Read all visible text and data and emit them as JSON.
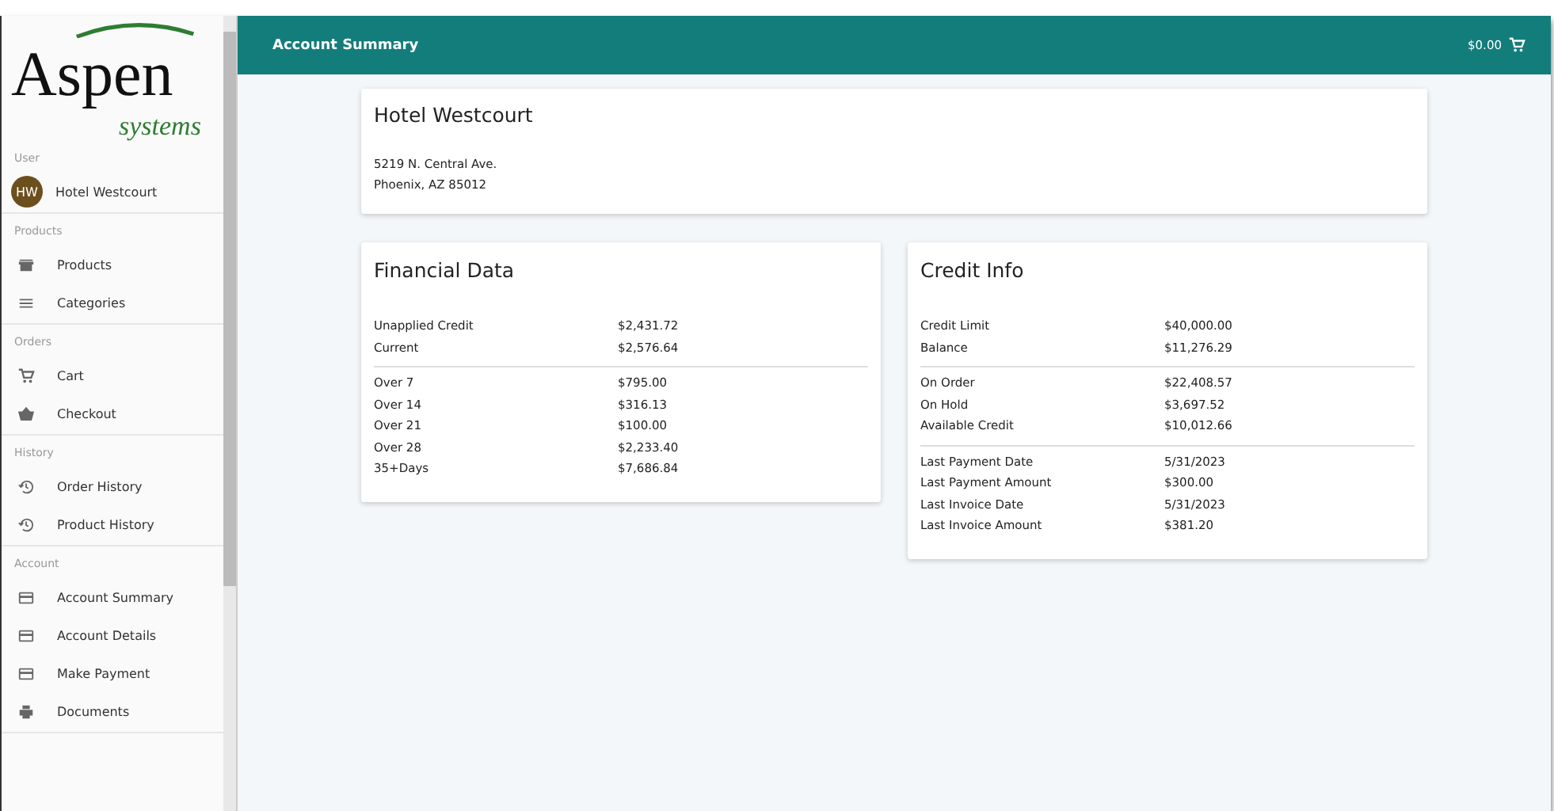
{
  "logo": {
    "main": "Aspen",
    "sub": "systems"
  },
  "sidebar": {
    "sections": [
      {
        "label": "User",
        "items": [
          {
            "kind": "avatar",
            "initials": "HW",
            "label": "Hotel Westcourt"
          }
        ]
      },
      {
        "label": "Products",
        "items": [
          {
            "kind": "store",
            "label": "Products"
          },
          {
            "kind": "list",
            "label": "Categories"
          }
        ]
      },
      {
        "label": "Orders",
        "items": [
          {
            "kind": "cart",
            "label": "Cart"
          },
          {
            "kind": "basket",
            "label": "Checkout"
          }
        ]
      },
      {
        "label": "History",
        "items": [
          {
            "kind": "history",
            "label": "Order History"
          },
          {
            "kind": "history",
            "label": "Product History"
          }
        ]
      },
      {
        "label": "Account",
        "items": [
          {
            "kind": "card",
            "label": "Account Summary"
          },
          {
            "kind": "card",
            "label": "Account Details"
          },
          {
            "kind": "card",
            "label": "Make Payment"
          },
          {
            "kind": "printer",
            "label": "Documents"
          }
        ]
      }
    ]
  },
  "header": {
    "title": "Account Summary",
    "cart_total": "$0.00"
  },
  "address_card": {
    "name": "Hotel Westcourt",
    "lines": [
      "5219 N. Central Ave.",
      "Phoenix, AZ 85012"
    ]
  },
  "cards": [
    {
      "title": "Financial Data",
      "groups": [
        [
          {
            "label": "Unapplied Credit",
            "value": "$2,431.72"
          },
          {
            "label": "Current",
            "value": "$2,576.64"
          }
        ],
        [
          {
            "label": "Over 7",
            "value": "$795.00"
          },
          {
            "label": "Over 14",
            "value": "$316.13"
          },
          {
            "label": "Over 21",
            "value": "$100.00"
          },
          {
            "label": "Over 28",
            "value": "$2,233.40"
          },
          {
            "label": "35+Days",
            "value": "$7,686.84"
          }
        ]
      ]
    },
    {
      "title": "Credit Info",
      "groups": [
        [
          {
            "label": "Credit Limit",
            "value": "$40,000.00"
          },
          {
            "label": "Balance",
            "value": "$11,276.29"
          }
        ],
        [
          {
            "label": "On Order",
            "value": "$22,408.57"
          },
          {
            "label": "On Hold",
            "value": "$3,697.52"
          },
          {
            "label": "Available Credit",
            "value": "$10,012.66"
          }
        ],
        [
          {
            "label": "Last Payment Date",
            "value": "5/31/2023"
          },
          {
            "label": "Last Payment Amount",
            "value": "$300.00"
          },
          {
            "label": "Last Invoice Date",
            "value": "5/31/2023"
          },
          {
            "label": "Last Invoice Amount",
            "value": "$381.20"
          }
        ]
      ]
    }
  ]
}
